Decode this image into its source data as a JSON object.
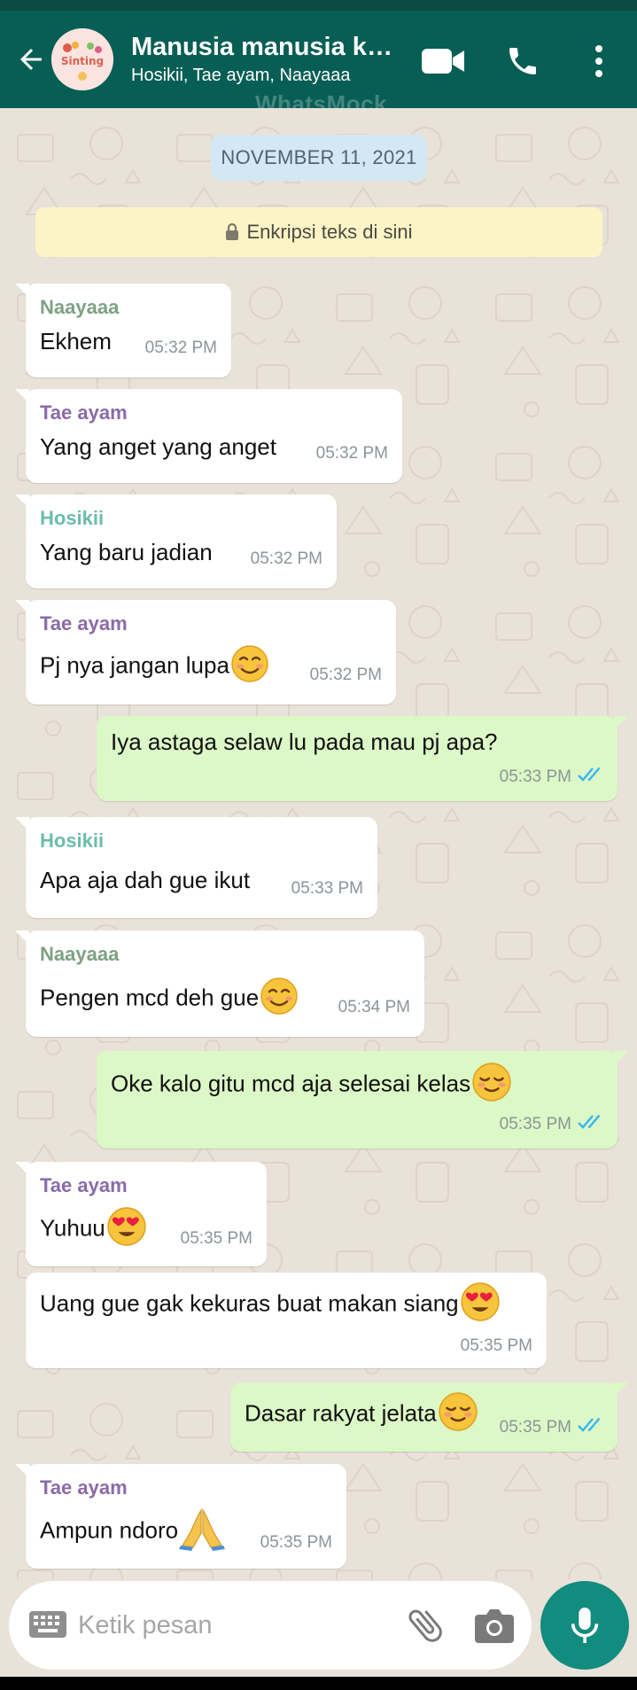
{
  "header": {
    "group_name": "Manusia manusia ku…",
    "members": "Hosikii, Tae ayam, Naayaaa",
    "watermark": "WhatsMock",
    "avatar_text": "Sinting"
  },
  "chat": {
    "date_label": "NOVEMBER 11, 2021",
    "encryption_note": "Enkripsi teks di sini",
    "messages": [
      {
        "direction": "in",
        "sender": "Naayaaa",
        "sender_color": "#7ea184",
        "text": "Ekhem",
        "time": "05:32 PM"
      },
      {
        "direction": "in",
        "sender": "Tae ayam",
        "sender_color": "#8a6aa8",
        "text": "Yang anget yang anget",
        "time": "05:32 PM"
      },
      {
        "direction": "in",
        "sender": "Hosikii",
        "sender_color": "#6cbcaa",
        "text": "Yang baru jadian",
        "time": "05:32 PM"
      },
      {
        "direction": "in",
        "sender": "Tae ayam",
        "sender_color": "#8a6aa8",
        "text": "Pj nya jangan lupa",
        "emoji": "smiling-face-icon",
        "time": "05:32 PM"
      },
      {
        "direction": "out",
        "text": "Iya astaga selaw lu pada mau pj apa?",
        "time": "05:33 PM",
        "status": "read"
      },
      {
        "direction": "in",
        "sender": "Hosikii",
        "sender_color": "#6cbcaa",
        "text": "Apa aja dah gue ikut",
        "time": "05:33 PM"
      },
      {
        "direction": "in",
        "sender": "Naayaaa",
        "sender_color": "#7ea184",
        "text": "Pengen mcd deh gue",
        "emoji": "smiling-face-icon",
        "time": "05:34 PM"
      },
      {
        "direction": "out",
        "text": "Oke kalo gitu mcd aja selesai kelas",
        "emoji": "relieved-face-icon",
        "time": "05:35 PM",
        "status": "read"
      },
      {
        "direction": "in",
        "sender": "Tae ayam",
        "sender_color": "#8a6aa8",
        "text": "Yuhuu",
        "emoji": "heart-eyes-icon",
        "time": "05:35 PM"
      },
      {
        "direction": "in",
        "text": "Uang gue gak kekuras buat makan siang",
        "emoji": "heart-eyes-icon",
        "time": "05:35 PM"
      },
      {
        "direction": "out",
        "text": "Dasar rakyat jelata",
        "emoji": "relieved-face-icon",
        "time": "05:35 PM",
        "status": "read"
      },
      {
        "direction": "in",
        "sender": "Tae ayam",
        "sender_color": "#8a6aa8",
        "text": "Ampun ndoro",
        "emoji": "folded-hands-icon",
        "time": "05:35 PM"
      }
    ]
  },
  "composer": {
    "placeholder": "Ketik pesan"
  },
  "colors": {
    "header": "#075e54",
    "outgoing_bubble": "#dcf8c6",
    "incoming_bubble": "#ffffff",
    "read_ticks": "#34b7f1",
    "mic_button": "#128c7e"
  }
}
